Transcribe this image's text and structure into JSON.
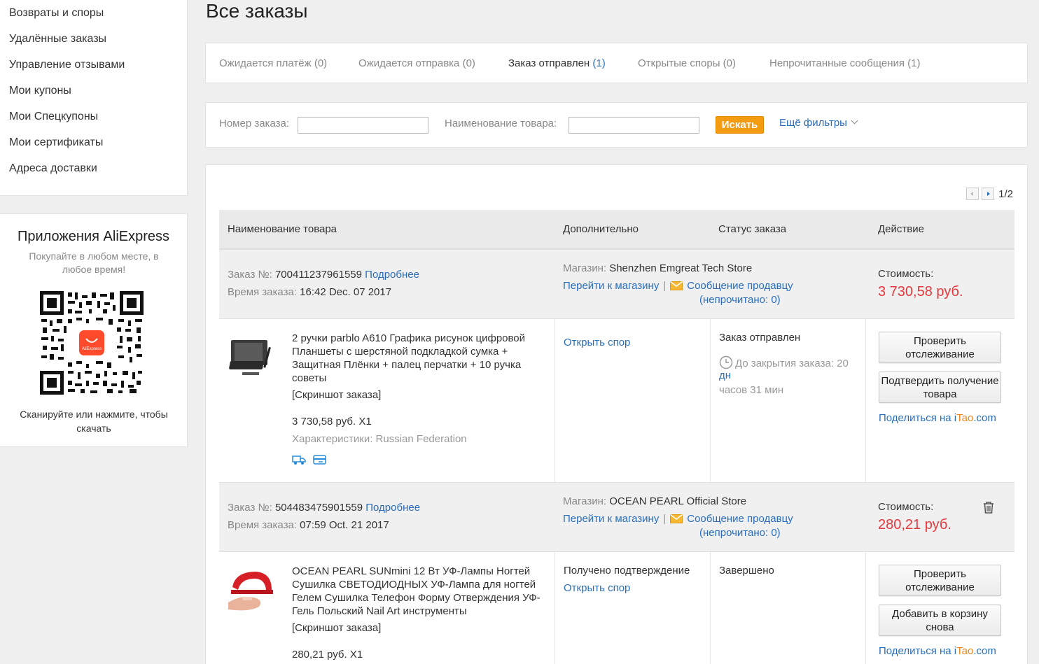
{
  "sidebar": {
    "items": [
      {
        "label": "Возвраты и споры"
      },
      {
        "label": "Удалённые заказы"
      },
      {
        "label": "Управление отзывами"
      },
      {
        "label": "Мои купоны"
      },
      {
        "label": "Мои Спецкупоны"
      },
      {
        "label": "Мои сертификаты"
      },
      {
        "label": "Адреса доставки"
      }
    ]
  },
  "app_promo": {
    "title": "Приложения AliExpress",
    "subtitle": "Покупайте в любом месте, в любое время!",
    "qr_logo_text": "AliExpress",
    "scan_text": "Сканируйте или нажмите, чтобы скачать"
  },
  "page_title": "Все заказы",
  "tabs": [
    {
      "label": "Ожидается платёж",
      "count": "(0)"
    },
    {
      "label": "Ожидается отправка",
      "count": "(0)"
    },
    {
      "label": "Заказ отправлен",
      "count": "(1)"
    },
    {
      "label": "Открытые споры",
      "count": "(0)"
    },
    {
      "label": "Непрочитанные сообщения",
      "count": "(1)"
    }
  ],
  "filters": {
    "order_number_label": "Номер заказа:",
    "order_number_value": "",
    "product_name_label": "Наименование товара:",
    "product_name_value": "",
    "search_button": "Искать",
    "more_filters": "Ещё фильтры"
  },
  "pagination": {
    "text": "1/2"
  },
  "table_headers": {
    "product": "Наименование товара",
    "extra": "Дополнительно",
    "status": "Статус заказа",
    "action": "Действие"
  },
  "orders": [
    {
      "order_label": "Заказ №:",
      "order_number": "700411237961559",
      "details_link": "Подробнее",
      "time_label": "Время заказа:",
      "time": "16:42 Dec. 07 2017",
      "store_label": "Магазин:",
      "store_name": "Shenzhen Emgreat Tech Store",
      "go_to_store": "Перейти к магазину",
      "separator": "|",
      "message_seller": "Сообщение продавцу",
      "unread_prefix": "(непрочитано: ",
      "unread_count": "0",
      "unread_suffix": ")",
      "cost_label": "Стоимость:",
      "cost": "3 730,58 руб.",
      "item": {
        "title": "2 ручки parblo A610 Графика рисунок цифровой Планшеты с шерстяной подкладкой сумка + Защитная Плёнки + палец перчатки + 10 ручка советы",
        "snapshot": "[Скриншот заказа]",
        "price_qty": "3 730,58 руб. X1",
        "specs": "Характеристики: Russian Federation"
      },
      "extra": {
        "confirmation": "",
        "dispute_link": "Открыть спор"
      },
      "status": {
        "text": "Заказ отправлен",
        "countdown_prefix": "До закрытия заказа: 20",
        "countdown_days": "дн",
        "countdown_rest": "часов 31 мин"
      },
      "actions": {
        "button1": "Проверить отслеживание",
        "button2": "Подтвердить получение товара",
        "share_prefix": "Поделиться на ",
        "share_i": "i",
        "share_tao": "Tao",
        "share_com": ".com"
      }
    },
    {
      "order_label": "Заказ №:",
      "order_number": "504483475901559",
      "details_link": "Подробнее",
      "time_label": "Время заказа:",
      "time": "07:59 Oct. 21 2017",
      "store_label": "Магазин:",
      "store_name": "OCEAN PEARL Official Store",
      "go_to_store": "Перейти к магазину",
      "separator": "|",
      "message_seller": "Сообщение продавцу",
      "unread_prefix": "(непрочитано: ",
      "unread_count": "0",
      "unread_suffix": ")",
      "cost_label": "Стоимость:",
      "cost": "280,21 руб.",
      "item": {
        "title": "OCEAN PEARL SUNmini 12 Вт УФ-Лампы Ногтей Сушилка СВЕТОДИОДНЫХ УФ-Лампа для ногтей Гелем Сушилка Телефон Форму Отверждения УФ-Гель Польский Nail Art инструменты",
        "snapshot": "[Скриншот заказа]",
        "price_qty": "280,21 руб. X1"
      },
      "extra": {
        "confirmation": "Получено подтверждение",
        "dispute_link": "Открыть спор"
      },
      "status": {
        "text": "Завершено"
      },
      "actions": {
        "button1": "Проверить отслеживание",
        "button2": "Добавить в корзину снова",
        "share_prefix": "Поделиться на ",
        "share_i": "i",
        "share_tao": "Tao",
        "share_com": ".com"
      }
    }
  ],
  "colors": {
    "link": "#2a6ebb",
    "price": "#e4393c",
    "search_button": "#f39c12",
    "background": "#efefef"
  }
}
